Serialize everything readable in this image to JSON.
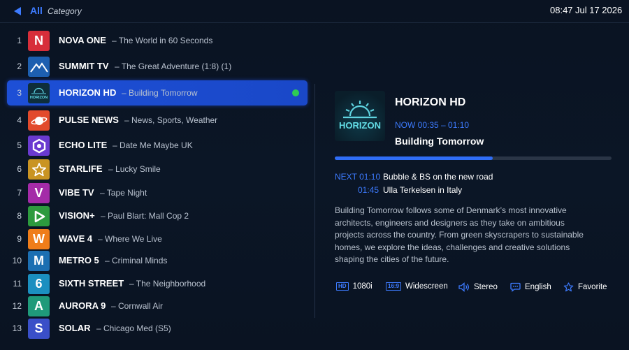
{
  "header": {
    "back_label": "All",
    "category_label": "Category",
    "time": "08:47",
    "date": "Jul 17 2026"
  },
  "channels": [
    {
      "num": "1",
      "logo": "N",
      "logo_bg": "#d72e3a",
      "name": "NOVA ONE",
      "program": "The World in 60 Seconds"
    },
    {
      "num": "2",
      "logo": "mountain",
      "logo_bg": "#1d5fb0",
      "name": "SUMMIT TV",
      "program": "The Great Adventure (1:8) (1)"
    },
    {
      "num": "3",
      "logo": "HORIZON",
      "logo_bg": "#0e2e3b",
      "name": "HORIZON HD",
      "program": "Building Tomorrow",
      "selected": true,
      "live": true
    },
    {
      "num": "4",
      "logo": "planet",
      "logo_bg": "#e24a2c",
      "name": "PULSE NEWS",
      "program": "News, Sports, Weather"
    },
    {
      "num": "5",
      "logo": "hex",
      "logo_bg": "#6a3ad0",
      "name": "ECHO LITE",
      "program": "Date Me Maybe UK"
    },
    {
      "num": "6",
      "logo": "★",
      "logo_bg": "#c99423",
      "name": "STARLIFE",
      "program": "Lucky Smile"
    },
    {
      "num": "7",
      "logo": "V",
      "logo_bg": "#a42ba8",
      "name": "VIBE TV",
      "program": "Tape Night"
    },
    {
      "num": "8",
      "logo": "play",
      "logo_bg": "#2d9a3e",
      "name": "VISION+",
      "program": "Paul Blart: Mall Cop 2"
    },
    {
      "num": "9",
      "logo": "W",
      "logo_bg": "#ef7d1a",
      "name": "WAVE 4",
      "program": "Where We Live"
    },
    {
      "num": "10",
      "logo": "M",
      "logo_bg": "#1c6fb2",
      "name": "METRO 5",
      "program": "Criminal Minds"
    },
    {
      "num": "11",
      "logo": "6",
      "logo_bg": "#1b8fc0",
      "name": "SIXTH STREET",
      "program": "The Neighborhood"
    },
    {
      "num": "12",
      "logo": "A",
      "logo_bg": "#1f9a7a",
      "name": "AURORA 9",
      "program": "Cornwall Air"
    },
    {
      "num": "13",
      "logo": "S",
      "logo_bg": "#3a4fc8",
      "name": "SOLAR",
      "program": "Chicago Med (S5)"
    }
  ],
  "detail": {
    "logo_text": "HORIZON",
    "title": "HORIZON HD",
    "now_label": "NOW 00:35 – 01:10",
    "now_title": "Building Tomorrow",
    "progress": 0.57,
    "next_label": "NEXT 01:10",
    "next_title": "Bubble & BS on the new road",
    "next2_time": "01:45",
    "next2_title": "Ulla Terkelsen in Italy",
    "description": "Building Tomorrow follows some of Denmark’s most innovative architects, engineers and designers as they take on ambitious projects across the country. From green skyscrapers to sustainable homes, we explore the ideas, challenges and creative solutions shaping the cities of the future.",
    "features": {
      "hd_badge": "HD",
      "resolution": "1080i",
      "aspect_badge": "16:9",
      "aspect": "Widescreen",
      "audio": "Stereo",
      "language": "English",
      "favorite": "Favorite"
    }
  },
  "colors": {
    "accent": "#3d7bff",
    "live": "#2ecc55",
    "selected_bg": "#1d4fd6"
  }
}
